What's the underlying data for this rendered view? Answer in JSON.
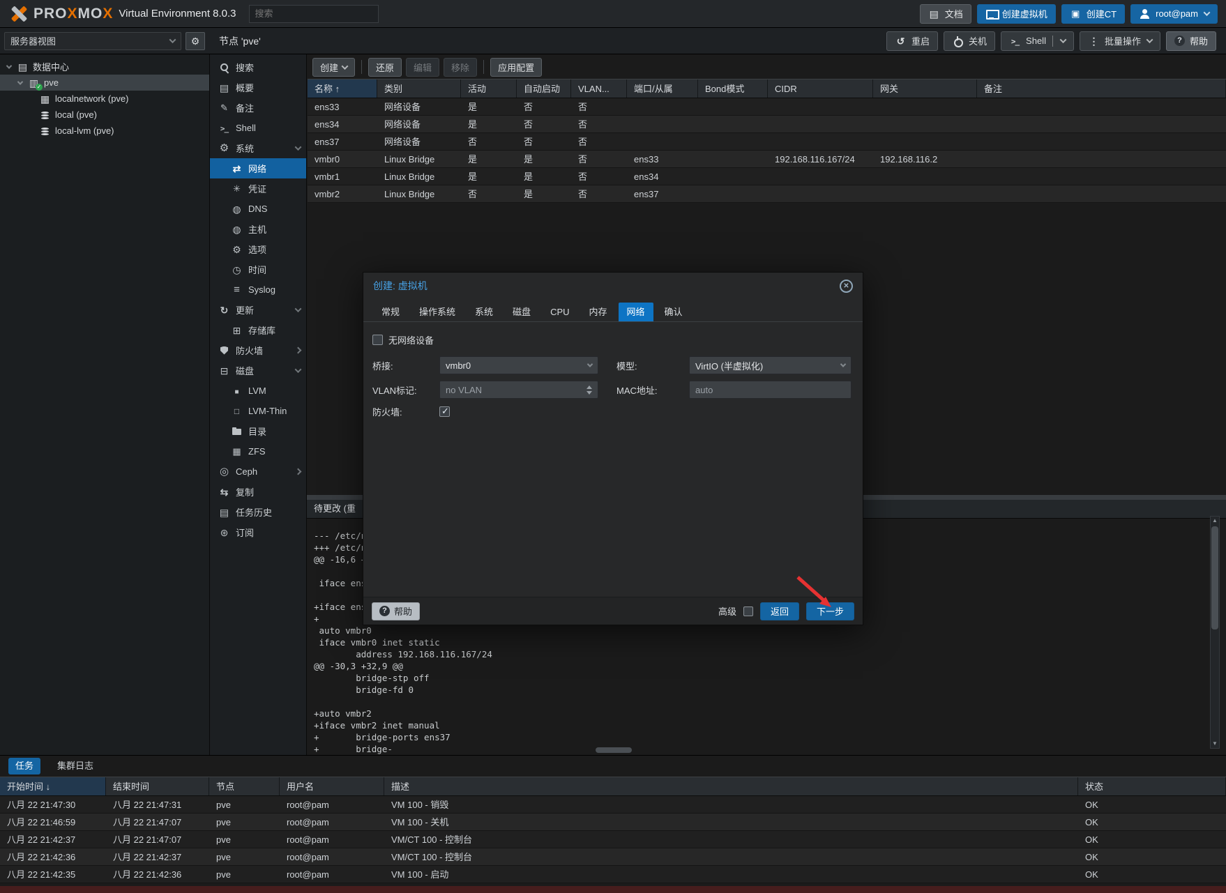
{
  "icons": {
    "close": "✕",
    "sort_asc": "↑",
    "sort_desc": "↓"
  },
  "header": {
    "logo": {
      "brand": [
        "PRO",
        "X",
        "MO",
        "X"
      ],
      "product": "Virtual Environment 8.0.3"
    },
    "search_placeholder": "搜索",
    "buttons": {
      "docs": "文档",
      "create_vm": "创建虚拟机",
      "create_ct": "创建CT",
      "user": "root@pam"
    }
  },
  "resource_tree": {
    "view_selector": "服务器视图",
    "items": [
      {
        "label": "数据中心"
      },
      {
        "label": "pve"
      },
      {
        "label": "localnetwork (pve)"
      },
      {
        "label": "local (pve)"
      },
      {
        "label": "local-lvm (pve)"
      }
    ]
  },
  "node_panel": {
    "title": "节点 'pve'",
    "buttons": {
      "reboot": "重启",
      "shutdown": "关机",
      "shell": "Shell",
      "bulk_actions": "批量操作",
      "help": "帮助"
    }
  },
  "menu": {
    "items": [
      {
        "label": "搜索"
      },
      {
        "label": "概要"
      },
      {
        "label": "备注"
      },
      {
        "label": "Shell"
      },
      {
        "label": "系统"
      },
      {
        "label": "网络"
      },
      {
        "label": "凭证"
      },
      {
        "label": "DNS"
      },
      {
        "label": "主机"
      },
      {
        "label": "选项"
      },
      {
        "label": "时间"
      },
      {
        "label": "Syslog"
      },
      {
        "label": "更新"
      },
      {
        "label": "存储库"
      },
      {
        "label": "防火墙"
      },
      {
        "label": "磁盘"
      },
      {
        "label": "LVM"
      },
      {
        "label": "LVM-Thin"
      },
      {
        "label": "目录"
      },
      {
        "label": "ZFS"
      },
      {
        "label": "Ceph"
      },
      {
        "label": "复制"
      },
      {
        "label": "任务历史"
      },
      {
        "label": "订阅"
      }
    ]
  },
  "network_view": {
    "toolbar": {
      "create": "创建",
      "revert": "还原",
      "edit": "编辑",
      "remove": "移除",
      "apply": "应用配置"
    },
    "table": {
      "columns": [
        "名称",
        "类别",
        "活动",
        "自动启动",
        "VLAN...",
        "端口/从属",
        "Bond模式",
        "CIDR",
        "网关",
        "备注"
      ],
      "rows": [
        [
          "ens33",
          "网络设备",
          "是",
          "否",
          "否",
          "",
          "",
          "",
          "",
          ""
        ],
        [
          "ens34",
          "网络设备",
          "是",
          "否",
          "否",
          "",
          "",
          "",
          "",
          ""
        ],
        [
          "ens37",
          "网络设备",
          "否",
          "否",
          "否",
          "",
          "",
          "",
          "",
          ""
        ],
        [
          "vmbr0",
          "Linux Bridge",
          "是",
          "是",
          "否",
          "ens33",
          "",
          "192.168.116.167/24",
          "192.168.116.2",
          ""
        ],
        [
          "vmbr1",
          "Linux Bridge",
          "是",
          "是",
          "否",
          "ens34",
          "",
          "",
          "",
          ""
        ],
        [
          "vmbr2",
          "Linux Bridge",
          "否",
          "是",
          "否",
          "ens37",
          "",
          "",
          "",
          ""
        ]
      ]
    },
    "pending": {
      "title": "待更改 (重",
      "lines": [
        "--- /etc/n",
        "+++ /etc/n",
        "@@ -16,6 +",
        "",
        " iface ens3",
        "",
        "+iface ens3",
        "+",
        " auto vmbr0",
        " iface vmbr0 inet static",
        "        address 192.168.116.167/24",
        "@@ -30,3 +32,9 @@",
        "        bridge-stp off",
        "        bridge-fd 0",
        "",
        "+auto vmbr2",
        "+iface vmbr2 inet manual",
        "+       bridge-ports ens37",
        "+       bridge-"
      ]
    }
  },
  "dialog": {
    "title": "创建: 虚拟机",
    "tabs": [
      "常规",
      "操作系统",
      "系统",
      "磁盘",
      "CPU",
      "内存",
      "网络",
      "确认"
    ],
    "no_network_device": "无网络设备",
    "fields": {
      "bridge_label": "桥接:",
      "bridge_value": "vmbr0",
      "vlan_label": "VLAN标记:",
      "vlan_placeholder": "no VLAN",
      "firewall_label": "防火墙:",
      "model_label": "模型:",
      "model_value": "VirtIO (半虚拟化)",
      "mac_label": "MAC地址:",
      "mac_placeholder": "auto"
    },
    "footer": {
      "help": "帮助",
      "advanced": "高级",
      "back": "返回",
      "next": "下一步"
    }
  },
  "tasks": {
    "tabs": {
      "tasks": "任务",
      "cluster_log": "集群日志"
    },
    "columns": [
      "开始时间",
      "结束时间",
      "节点",
      "用户名",
      "描述",
      "状态"
    ],
    "rows": [
      [
        "八月 22 21:47:30",
        "八月 22 21:47:31",
        "pve",
        "root@pam",
        "VM 100 - 销毁",
        "OK"
      ],
      [
        "八月 22 21:46:59",
        "八月 22 21:47:07",
        "pve",
        "root@pam",
        "VM 100 - 关机",
        "OK"
      ],
      [
        "八月 22 21:42:37",
        "八月 22 21:47:07",
        "pve",
        "root@pam",
        "VM/CT 100 - 控制台",
        "OK"
      ],
      [
        "八月 22 21:42:36",
        "八月 22 21:42:37",
        "pve",
        "root@pam",
        "VM/CT 100 - 控制台",
        "OK"
      ],
      [
        "八月 22 21:42:35",
        "八月 22 21:42:36",
        "pve",
        "root@pam",
        "VM 100 - 启动",
        "OK"
      ]
    ]
  }
}
